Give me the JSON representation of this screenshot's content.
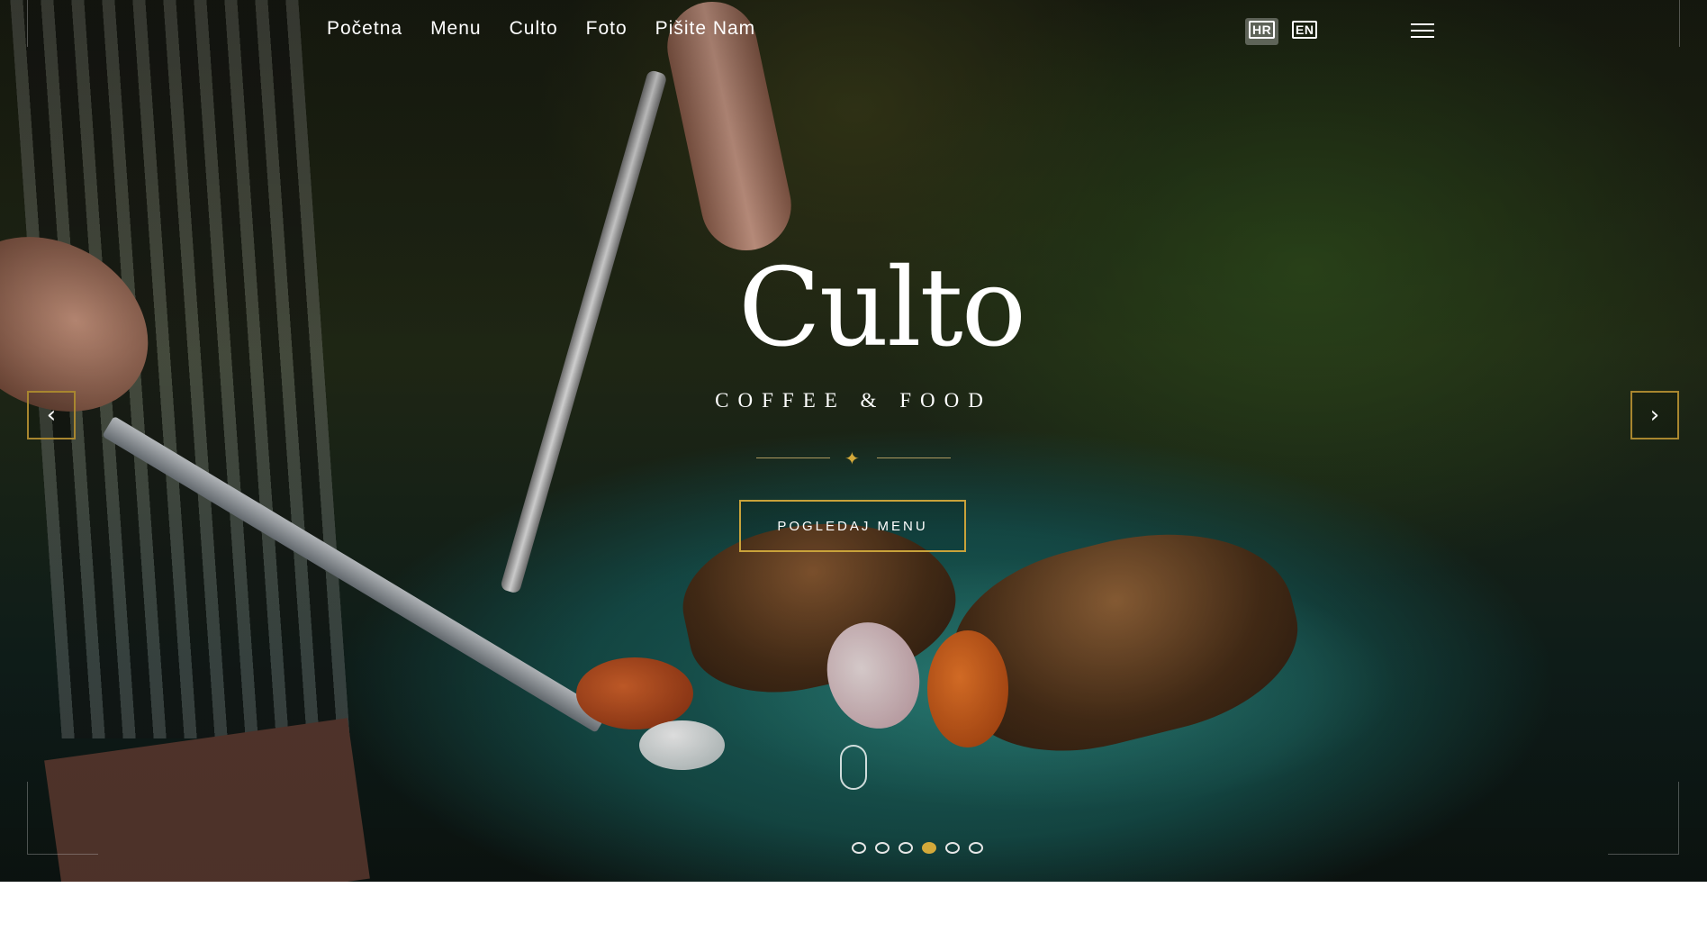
{
  "nav": {
    "items": [
      "Početna",
      "Menu",
      "Culto",
      "Foto",
      "Pišite Nam"
    ]
  },
  "lang": {
    "hr": "HR",
    "en": "EN",
    "active": "HR"
  },
  "hero": {
    "logo": "Culto",
    "tagline": "COFFEE & FOOD",
    "cta": "POGLEDAJ MENU",
    "prev": "‹",
    "next": "›",
    "slides_total": 6,
    "slide_active": 4
  },
  "colors": {
    "accent": "#c9a23a",
    "text": "#ffffff"
  },
  "icons": [
    "menu-icon",
    "chevron-left-icon",
    "chevron-right-icon",
    "scroll-mouse-icon",
    "star-icon"
  ]
}
